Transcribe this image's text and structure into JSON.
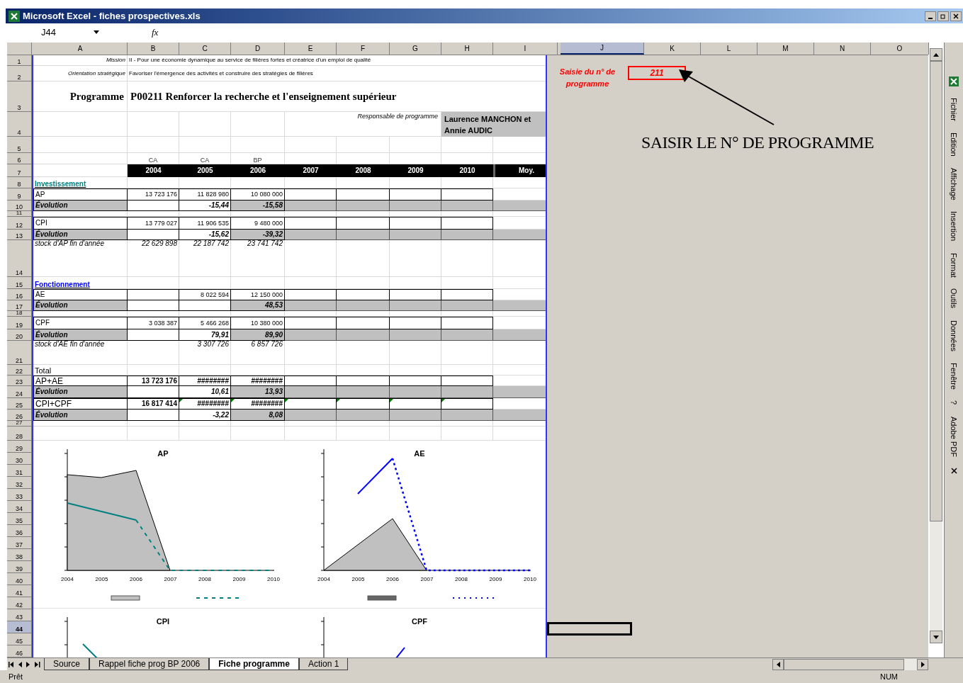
{
  "window": {
    "title": "Microsoft Excel - fiches prospectives.xls"
  },
  "formula_bar": {
    "name_box": "J44",
    "fx": "fx"
  },
  "columns": [
    {
      "label": "A",
      "selected": false
    },
    {
      "label": "B",
      "selected": false
    },
    {
      "label": "C",
      "selected": false
    },
    {
      "label": "D",
      "selected": false
    },
    {
      "label": "E",
      "selected": false
    },
    {
      "label": "F",
      "selected": false
    },
    {
      "label": "G",
      "selected": false
    },
    {
      "label": "H",
      "selected": false
    },
    {
      "label": "I",
      "selected": false
    },
    {
      "label": "J",
      "selected": true
    },
    {
      "label": "K",
      "selected": false
    },
    {
      "label": "L",
      "selected": false
    },
    {
      "label": "M",
      "selected": false
    },
    {
      "label": "N",
      "selected": false
    },
    {
      "label": "O",
      "selected": false
    }
  ],
  "rows": [
    {
      "label": "1",
      "selected": false
    },
    {
      "label": "2",
      "selected": false
    },
    {
      "label": "3",
      "selected": false
    },
    {
      "label": "4",
      "selected": false
    },
    {
      "label": "5",
      "selected": false
    },
    {
      "label": "6",
      "selected": false
    },
    {
      "label": "7",
      "selected": false
    },
    {
      "label": "8",
      "selected": false
    },
    {
      "label": "9",
      "selected": false
    },
    {
      "label": "10",
      "selected": false
    },
    {
      "label": "11",
      "selected": false
    },
    {
      "label": "12",
      "selected": false
    },
    {
      "label": "13",
      "selected": false
    },
    {
      "label": "14",
      "selected": false
    },
    {
      "label": "15",
      "selected": false
    },
    {
      "label": "16",
      "selected": false
    },
    {
      "label": "17",
      "selected": false
    },
    {
      "label": "18",
      "selected": false
    },
    {
      "label": "19",
      "selected": false
    },
    {
      "label": "20",
      "selected": false
    },
    {
      "label": "21",
      "selected": false
    },
    {
      "label": "22",
      "selected": false
    },
    {
      "label": "23",
      "selected": false
    },
    {
      "label": "24",
      "selected": false
    },
    {
      "label": "25",
      "selected": false
    },
    {
      "label": "26",
      "selected": false
    },
    {
      "label": "27",
      "selected": false
    },
    {
      "label": "28",
      "selected": false
    },
    {
      "label": "29",
      "selected": false
    },
    {
      "label": "30",
      "selected": false
    },
    {
      "label": "31",
      "selected": false
    },
    {
      "label": "32",
      "selected": false
    },
    {
      "label": "33",
      "selected": false
    },
    {
      "label": "34",
      "selected": false
    },
    {
      "label": "35",
      "selected": false
    },
    {
      "label": "36",
      "selected": false
    },
    {
      "label": "37",
      "selected": false
    },
    {
      "label": "38",
      "selected": false
    },
    {
      "label": "39",
      "selected": false
    },
    {
      "label": "40",
      "selected": false
    },
    {
      "label": "41",
      "selected": false
    },
    {
      "label": "42",
      "selected": false
    },
    {
      "label": "43",
      "selected": false
    },
    {
      "label": "44",
      "selected": true
    },
    {
      "label": "45",
      "selected": false
    },
    {
      "label": "46",
      "selected": false
    }
  ],
  "sheet_rows": [
    {
      "kind": "info",
      "label": "Mission",
      "text": "II - Pour une économie dynamique au service de filières fortes et créatrice d'un emploi de qualité"
    },
    {
      "kind": "info",
      "label": "Orientation stratégique",
      "text": "Favoriser l'émergence des activités et construire des stratégies de filières"
    },
    {
      "kind": "title",
      "label": "Programme",
      "text": "P00211 Renforcer la recherche et l'enseignement supérieur"
    },
    {
      "kind": "manager",
      "label": "Responsable de programme",
      "text": "Laurence MANCHON et Annie AUDIC"
    },
    {
      "kind": "blank"
    },
    {
      "kind": "subheads",
      "values": [
        "CA",
        "CA",
        "BP"
      ]
    },
    {
      "kind": "years",
      "values": [
        "2004",
        "2005",
        "2006",
        "2007",
        "2008",
        "2009",
        "2010",
        "Moy."
      ]
    },
    {
      "kind": "section",
      "label": "Investissement",
      "color": "#008080"
    },
    {
      "kind": "data",
      "label": "AP",
      "values": {
        "B": "13 723 176",
        "C": "11 828 980",
        "D": "10 080 000"
      }
    },
    {
      "kind": "evolution",
      "label": "Évolution",
      "values": {
        "C": "-15,44",
        "D": "-15,58"
      }
    },
    {
      "kind": "blank"
    },
    {
      "kind": "data",
      "label": "CPI",
      "values": {
        "B": "13 779 027",
        "C": "11 906 535",
        "D": "9 480 000"
      }
    },
    {
      "kind": "evolution",
      "label": "Évolution",
      "values": {
        "C": "-15,62",
        "D": "-39,32"
      }
    },
    {
      "kind": "stock",
      "label": "stock d'AP fin d'année",
      "values": {
        "B": "22 629 898",
        "C": "22 187 742",
        "D": "23 741 742"
      }
    },
    {
      "kind": "section",
      "label": "Fonctionnement",
      "color": "#0000ff"
    },
    {
      "kind": "data",
      "label": "AE",
      "values": {
        "C": "8 022 594",
        "D": "12 150 000"
      }
    },
    {
      "kind": "evolution",
      "label": "Évolution",
      "values": {
        "D": "48,53"
      }
    },
    {
      "kind": "blank"
    },
    {
      "kind": "data",
      "label": "CPF",
      "values": {
        "B": "3 038 387",
        "C": "5 466 268",
        "D": "10 380 000"
      }
    },
    {
      "kind": "evolution",
      "label": "Évolution",
      "values": {
        "C": "79,91",
        "D": "89,90"
      }
    },
    {
      "kind": "stock",
      "label": "stock d'AE fin d'année",
      "values": {
        "C": "3 307 726",
        "D": "6 857 726"
      }
    },
    {
      "kind": "heading",
      "label": "Total"
    },
    {
      "kind": "total",
      "label": "AP+AE",
      "values": {
        "B": "13 723 176",
        "C": "########",
        "D": "########"
      },
      "flags": [
        false,
        false,
        false,
        false,
        false,
        false,
        false
      ]
    },
    {
      "kind": "evolution",
      "label": "Évolution",
      "values": {
        "C": "10,61",
        "D": "13,93"
      }
    },
    {
      "kind": "total",
      "label": "CPI+CPF",
      "values": {
        "B": "16 817 414",
        "C": "########",
        "D": "########"
      },
      "flags": [
        false,
        true,
        true,
        true,
        true,
        true,
        true
      ]
    },
    {
      "kind": "evolution",
      "label": "Évolution",
      "values": {
        "C": "-3,22",
        "D": "8,08"
      }
    },
    {
      "kind": "blank"
    },
    {
      "kind": "blank"
    }
  ],
  "charts": [
    {
      "title": "AP",
      "color": "#008080",
      "x_labels": [
        "2004",
        "2005",
        "2006",
        "2007",
        "2008",
        "2009",
        "2010"
      ]
    },
    {
      "title": "AE",
      "color": "#0000ff",
      "x_labels": [
        "2004",
        "2005",
        "2006",
        "2007",
        "2008",
        "2009",
        "2010"
      ]
    },
    {
      "title": "CPI",
      "color": "#008080"
    },
    {
      "title": "CPF",
      "color": "#0000ff"
    }
  ],
  "note": {
    "label": "Saisie du n° de programme",
    "value": "211",
    "instruction": "SAISIR LE N° DE PROGRAMME"
  },
  "menu": [
    "Fichier",
    "Edition",
    "Affichage",
    "Insertion",
    "Format",
    "Outils",
    "Données",
    "Fenêtre",
    "?",
    "Adobe PDF"
  ],
  "sheet_tabs": [
    {
      "label": "Source",
      "selected": false
    },
    {
      "label": "Rappel fiche prog BP 2006",
      "selected": false
    },
    {
      "label": "Fiche programme",
      "selected": true
    },
    {
      "label": "Action 1",
      "selected": false
    }
  ],
  "status_bar": {
    "left": "Prêt",
    "right": "NUM"
  }
}
